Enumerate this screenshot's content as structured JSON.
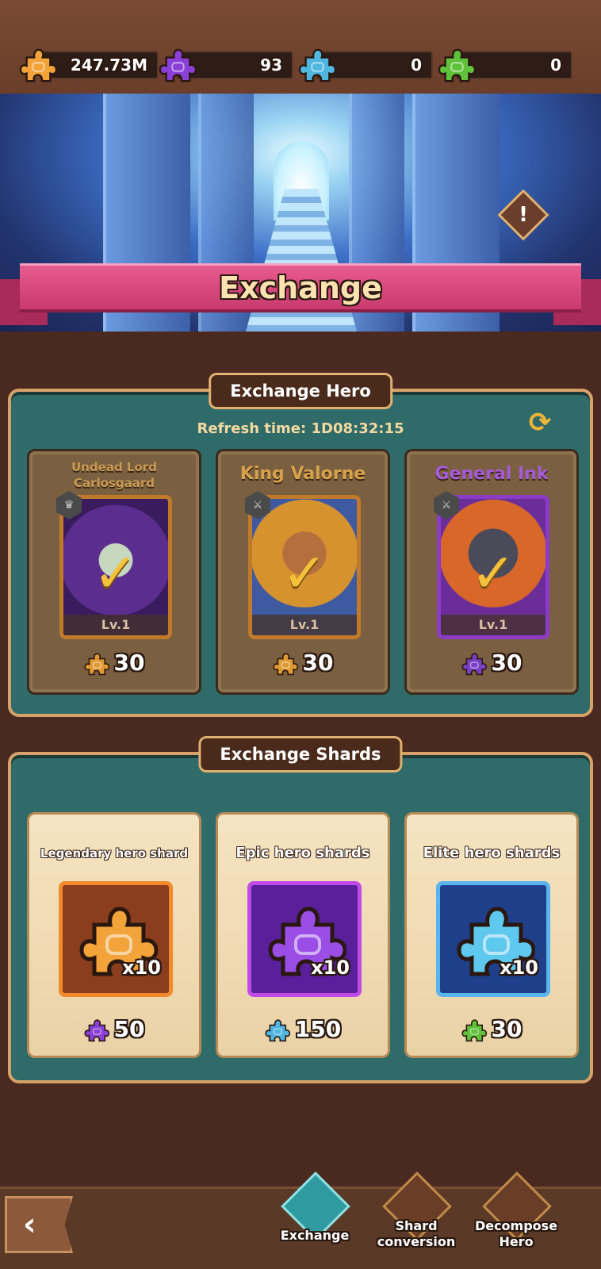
{
  "currencies": [
    {
      "icon": "legendary-shard-icon",
      "color": "#f2a33a",
      "value": "247.73M"
    },
    {
      "icon": "epic-shard-icon",
      "color": "#8a3fd6",
      "value": "93"
    },
    {
      "icon": "elite-shard-icon",
      "color": "#4fb6e0",
      "value": "0"
    },
    {
      "icon": "common-shard-icon",
      "color": "#5fc23a",
      "value": "0"
    }
  ],
  "banner": {
    "title": "Exchange"
  },
  "exchange_hero": {
    "title": "Exchange Hero",
    "refresh_label": "Refresh time: 1D08:32:15",
    "heroes": [
      {
        "name": "Undead Lord Carlosgaard",
        "level": "Lv.1",
        "cost": "30",
        "shard_color": "#e09a34"
      },
      {
        "name": "King Valorne",
        "level": "Lv.1",
        "cost": "30",
        "shard_color": "#e09a34"
      },
      {
        "name": "General Ink",
        "level": "Lv.1",
        "cost": "30",
        "shard_color": "#7a3fc6"
      }
    ]
  },
  "exchange_shards": {
    "title": "Exchange Shards",
    "items": [
      {
        "label": "Legendary hero shard",
        "qty": "x10",
        "cost": "50",
        "piece_color": "#f2a33a",
        "cost_color": "#8a3fd6"
      },
      {
        "label": "Epic hero shards",
        "qty": "x10",
        "cost": "150",
        "piece_color": "#9a4ee6",
        "cost_color": "#4fb6e0"
      },
      {
        "label": "Elite hero shards",
        "qty": "x10",
        "cost": "30",
        "piece_color": "#5fc8ee",
        "cost_color": "#5fc23a"
      }
    ]
  },
  "nav": {
    "exchange": "Exchange",
    "shard_conversion_1": "Shard",
    "shard_conversion_2": "conversion",
    "decompose_1": "Decompose",
    "decompose_2": "Hero"
  }
}
